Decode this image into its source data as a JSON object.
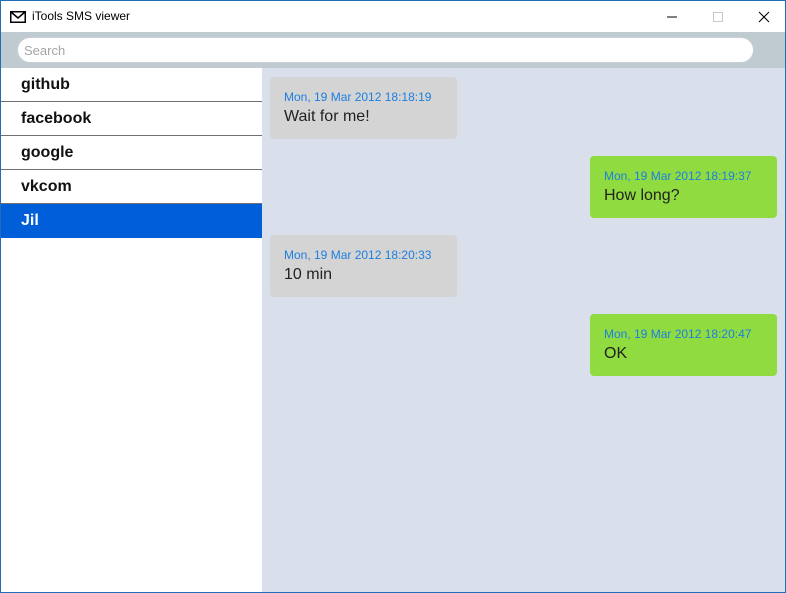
{
  "window": {
    "title": "iTools SMS viewer",
    "app_icon": "envelope-icon",
    "controls": [
      "minimize-icon",
      "maximize-icon",
      "close-icon"
    ]
  },
  "search": {
    "placeholder": "Search",
    "value": ""
  },
  "contacts": [
    {
      "name": "github",
      "selected": false
    },
    {
      "name": "facebook",
      "selected": false
    },
    {
      "name": "google",
      "selected": false
    },
    {
      "name": "vkcom",
      "selected": false
    },
    {
      "name": "Jil",
      "selected": true
    }
  ],
  "messages": [
    {
      "direction": "incoming",
      "timestamp": "Mon, 19 Mar 2012 18:18:19",
      "text": "Wait for me!"
    },
    {
      "direction": "outgoing",
      "timestamp": "Mon, 19 Mar 2012 18:19:37",
      "text": "How long?"
    },
    {
      "direction": "incoming",
      "timestamp": "Mon, 19 Mar 2012 18:20:33",
      "text": "10 min"
    },
    {
      "direction": "outgoing",
      "timestamp": "Mon, 19 Mar 2012 18:20:47",
      "text": "OK"
    }
  ],
  "colors": {
    "selected_contact": "#005ed9",
    "incoming_bubble": "#d4d4d4",
    "outgoing_bubble": "#8fdb40",
    "timestamp": "#1d7fe0",
    "chat_background": "#d9e0ec",
    "search_bar": "#bfcbd0"
  }
}
